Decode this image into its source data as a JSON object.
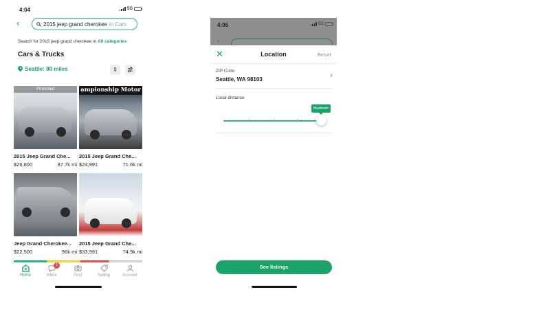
{
  "left": {
    "status": {
      "time": "4:04",
      "carrier": "5G",
      "battery": ""
    },
    "search": {
      "query": "2015 jeep grand cherokee",
      "scope": "in Cars"
    },
    "search_all": {
      "prefix": "Search for 2015 jeep grand cherokee in",
      "link": "All categories"
    },
    "section_title": "Cars & Trucks",
    "location": "Seattle: 80 miles",
    "listings": [
      {
        "title": "2015 Jeep Grand Che...",
        "price": "$26,800",
        "mileage": "87.7k mi",
        "promoted": "Promoted",
        "banner": ""
      },
      {
        "title": "2015 Jeep Grand Che...",
        "price": "$24,991",
        "mileage": "71.6k mi",
        "promoted": "",
        "banner": "ampionship Motor"
      },
      {
        "title": "Jeep Grand Cherokee...",
        "price": "$22,500",
        "mileage": "96k mi",
        "promoted": "",
        "banner": ""
      },
      {
        "title": "2015 Jeep Grand Che...",
        "price": "$33,991",
        "mileage": "74.9k mi",
        "promoted": "",
        "banner": ""
      }
    ],
    "tabs": [
      {
        "label": "Home",
        "icon": "home-icon"
      },
      {
        "label": "Inbox",
        "icon": "inbox-icon",
        "badge": "1"
      },
      {
        "label": "Post",
        "icon": "camera-icon"
      },
      {
        "label": "Selling",
        "icon": "tag-icon"
      },
      {
        "label": "Account",
        "icon": "person-icon"
      }
    ],
    "accent": "#1aa36b"
  },
  "right": {
    "status": {
      "time": "4:06",
      "carrier": "5G"
    },
    "sheet": {
      "title": "Location",
      "reset": "Reset",
      "zip_label": "ZIP Code",
      "zip_value": "Seattle, WA 98103",
      "distance_label": "Local distance",
      "slider_tooltip": "Maximum",
      "slider_value": 1.0,
      "cta": "See listings"
    }
  }
}
